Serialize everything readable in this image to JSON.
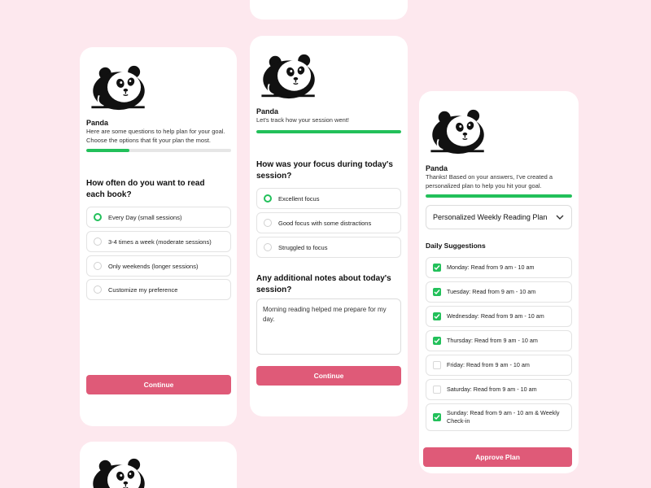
{
  "colors": {
    "background": "#fde8ee",
    "accent_green": "#22c05a",
    "button_pink": "#df5a78"
  },
  "card1": {
    "bot_name": "Panda",
    "intro": "Here are some questions to help plan for your goal. Choose the options that fit your plan the most.",
    "progress": 0.3,
    "question": "How often do you want to read each book?",
    "options": [
      {
        "label": "Every Day (small sessions)",
        "selected": true
      },
      {
        "label": "3-4 times a week (moderate sessions)",
        "selected": false
      },
      {
        "label": "Only weekends (longer sessions)",
        "selected": false
      },
      {
        "label": "Customize my preference",
        "selected": false
      }
    ],
    "continue_label": "Continue"
  },
  "card2": {
    "bot_name": "Panda",
    "intro": "Let's track how your session went!",
    "progress": 1.0,
    "question": "How was your focus during today's session?",
    "options": [
      {
        "label": "Excellent focus",
        "selected": true
      },
      {
        "label": "Good focus with some distractions",
        "selected": false
      },
      {
        "label": "Struggled to focus",
        "selected": false
      }
    ],
    "notes_question": "Any additional notes about today's session?",
    "notes_value": "Morning reading helped me prepare for my day.",
    "continue_label": "Continue"
  },
  "card3": {
    "bot_name": "Panda",
    "intro": "Thanks! Based on your answers, I've created a personalized plan to help you hit your goal.",
    "progress": 1.0,
    "plan_select": "Personalized Weekly Reading Plan",
    "section_title": "Daily Suggestions",
    "items": [
      {
        "label": "Monday: Read from 9 am - 10 am",
        "checked": true
      },
      {
        "label": "Tuesday: Read from 9 am - 10 am",
        "checked": true
      },
      {
        "label": "Wednesday: Read from 9 am - 10 am",
        "checked": true
      },
      {
        "label": "Thursday: Read from 9 am - 10 am",
        "checked": true
      },
      {
        "label": "Friday: Read from 9 am - 10 am",
        "checked": false
      },
      {
        "label": "Saturday: Read from 9 am - 10 am",
        "checked": false
      },
      {
        "label": "Sunday: Read from 9 am - 10 am & Weekly Check-in",
        "checked": true
      }
    ],
    "approve_label": "Approve Plan"
  }
}
